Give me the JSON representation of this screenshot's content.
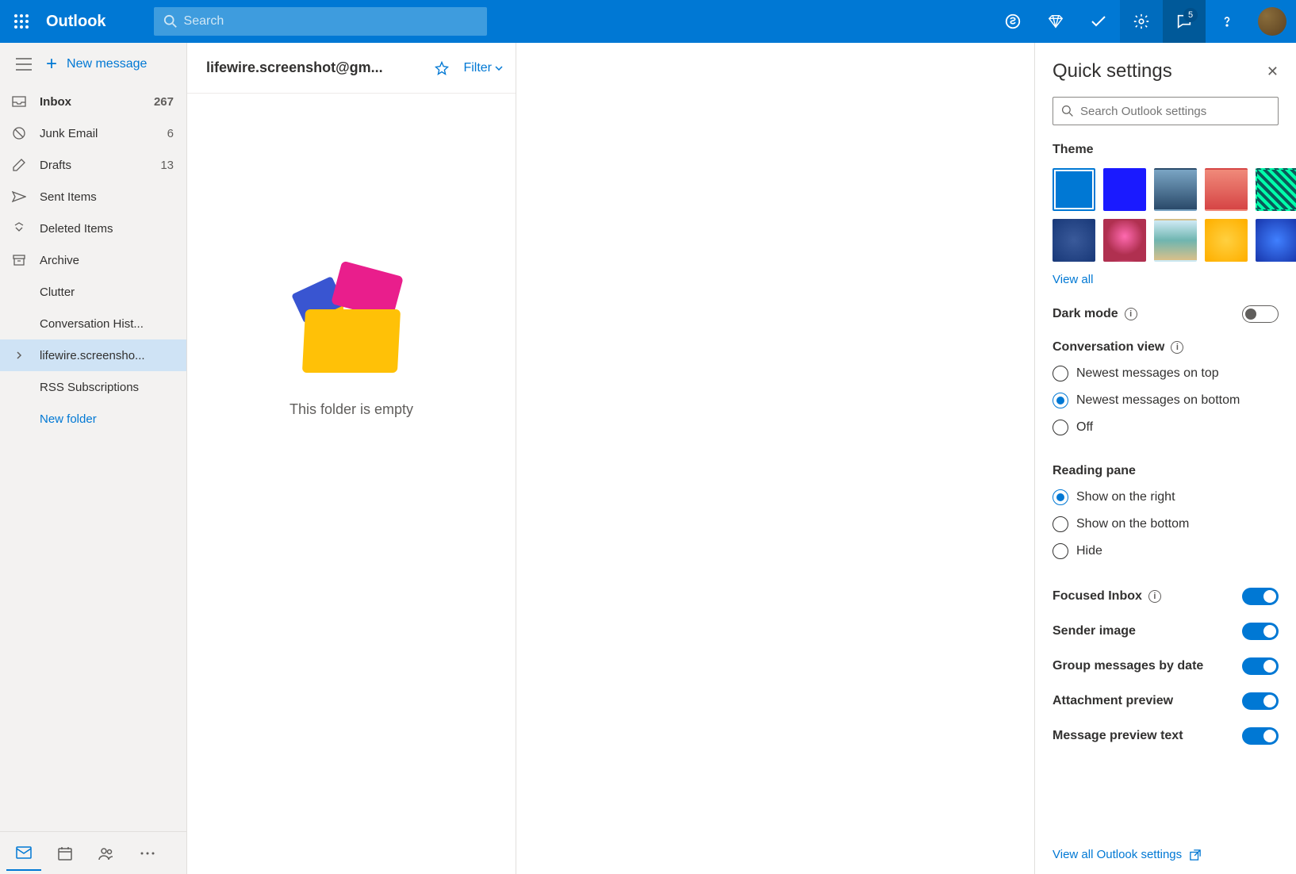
{
  "header": {
    "brand": "Outlook",
    "search_placeholder": "Search",
    "notification_count": "5"
  },
  "nav": {
    "new_message": "New message",
    "folders": [
      {
        "name": "Inbox",
        "count": "267",
        "icon": "inbox",
        "bold": true
      },
      {
        "name": "Junk Email",
        "count": "6",
        "icon": "junk"
      },
      {
        "name": "Drafts",
        "count": "13",
        "icon": "drafts"
      },
      {
        "name": "Sent Items",
        "count": "",
        "icon": "sent"
      },
      {
        "name": "Deleted Items",
        "count": "",
        "icon": "deleted"
      },
      {
        "name": "Archive",
        "count": "",
        "icon": "archive"
      },
      {
        "name": "Clutter",
        "count": "",
        "icon": ""
      },
      {
        "name": "Conversation Hist...",
        "count": "",
        "icon": ""
      },
      {
        "name": "lifewire.screensho...",
        "count": "",
        "icon": "chevron",
        "selected": true
      },
      {
        "name": "RSS Subscriptions",
        "count": "",
        "icon": ""
      },
      {
        "name": "New folder",
        "count": "",
        "icon": "",
        "link": true
      }
    ]
  },
  "list": {
    "folder_title": "lifewire.screenshot@gm...",
    "filter": "Filter",
    "empty_text": "This folder is empty"
  },
  "settings": {
    "title": "Quick settings",
    "search_placeholder": "Search Outlook settings",
    "theme_label": "Theme",
    "themes": [
      {
        "bg": "#0078d4",
        "selected": true
      },
      {
        "bg": "#1a1aff"
      },
      {
        "bg": "linear-gradient(180deg,#7aa5c4 0%,#2a4a6a 100%)"
      },
      {
        "bg": "linear-gradient(180deg,#f08a7a 0%,#d64545 100%)"
      },
      {
        "bg": "repeating-linear-gradient(45deg,#0a5a5a 0,#0a5a5a 4px,#0fa 4px,#0fa 8px)"
      },
      {
        "bg": "radial-gradient(circle,#3a5a9a 0%,#1a3a7a 100%)"
      },
      {
        "bg": "radial-gradient(circle at 50% 40%,#ff6ab0 0%,#b03050 60%)"
      },
      {
        "bg": "linear-gradient(180deg,#cfeaf5 0%,#6fb5b0 50%,#d9c08a 100%)"
      },
      {
        "bg": "radial-gradient(circle,#ffd040 0%,#ffb000 100%)"
      },
      {
        "bg": "radial-gradient(circle,#4080ff 0%,#1a3ab0 100%)"
      }
    ],
    "view_all": "View all",
    "dark_mode_label": "Dark mode",
    "conversation_view_label": "Conversation view",
    "conversation_options": [
      {
        "label": "Newest messages on top",
        "checked": false
      },
      {
        "label": "Newest messages on bottom",
        "checked": true
      },
      {
        "label": "Off",
        "checked": false
      }
    ],
    "reading_pane_label": "Reading pane",
    "reading_options": [
      {
        "label": "Show on the right",
        "checked": true
      },
      {
        "label": "Show on the bottom",
        "checked": false
      },
      {
        "label": "Hide",
        "checked": false
      }
    ],
    "toggles": [
      {
        "label": "Focused Inbox",
        "info": true,
        "on": true
      },
      {
        "label": "Sender image",
        "info": false,
        "on": true
      },
      {
        "label": "Group messages by date",
        "info": false,
        "on": true
      },
      {
        "label": "Attachment preview",
        "info": false,
        "on": true
      },
      {
        "label": "Message preview text",
        "info": false,
        "on": true
      }
    ],
    "view_all_settings": "View all Outlook settings"
  }
}
